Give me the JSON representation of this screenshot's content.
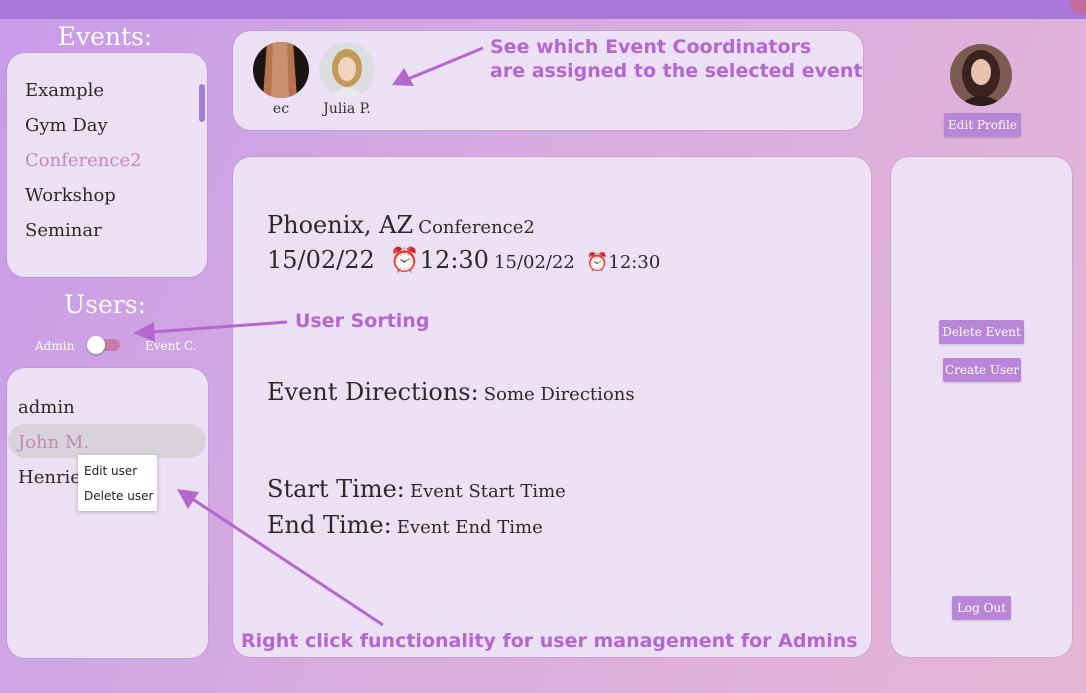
{
  "events_heading": "Events:",
  "events": [
    {
      "label": "Example",
      "selected": false
    },
    {
      "label": "Gym Day",
      "selected": false
    },
    {
      "label": "Conference2",
      "selected": true
    },
    {
      "label": "Workshop",
      "selected": false
    },
    {
      "label": "Seminar",
      "selected": false
    }
  ],
  "users_heading": "Users:",
  "toggle": {
    "left_label": "Admin",
    "right_label": "Event C."
  },
  "users": [
    {
      "label": "admin",
      "selected": false
    },
    {
      "label": "John M.",
      "selected": true
    },
    {
      "label": "Henriet",
      "selected": false
    }
  ],
  "context_menu": {
    "edit": "Edit user",
    "delete": "Delete user"
  },
  "coordinators": [
    {
      "name": "ec"
    },
    {
      "name": "Julia P."
    }
  ],
  "profile": {
    "edit_label": "Edit Profile"
  },
  "event_details": {
    "location": "Phoenix, AZ",
    "name": "Conference2",
    "start_date": "15/02/22",
    "start_time": "12:30",
    "end_date": "15/02/22",
    "end_time": "12:30",
    "directions_label": "Event Directions:",
    "directions_value": "Some Directions",
    "start_label": "Start Time:",
    "start_value": "Event Start Time",
    "end_label": "End Time:",
    "end_value": "Event End Time"
  },
  "actions": {
    "delete_event": "Delete Event",
    "create_user": "Create User",
    "log_out": "Log Out"
  },
  "annotations": {
    "coordinators_line1": "See which Event Coordinators",
    "coordinators_line2": "are assigned to the selected event",
    "sorting": "User Sorting",
    "right_click": "Right click functionality for user management for Admins"
  },
  "colors": {
    "accent": "#b985d6",
    "annotation": "#b566cf",
    "selected_text": "#c28ab6"
  }
}
